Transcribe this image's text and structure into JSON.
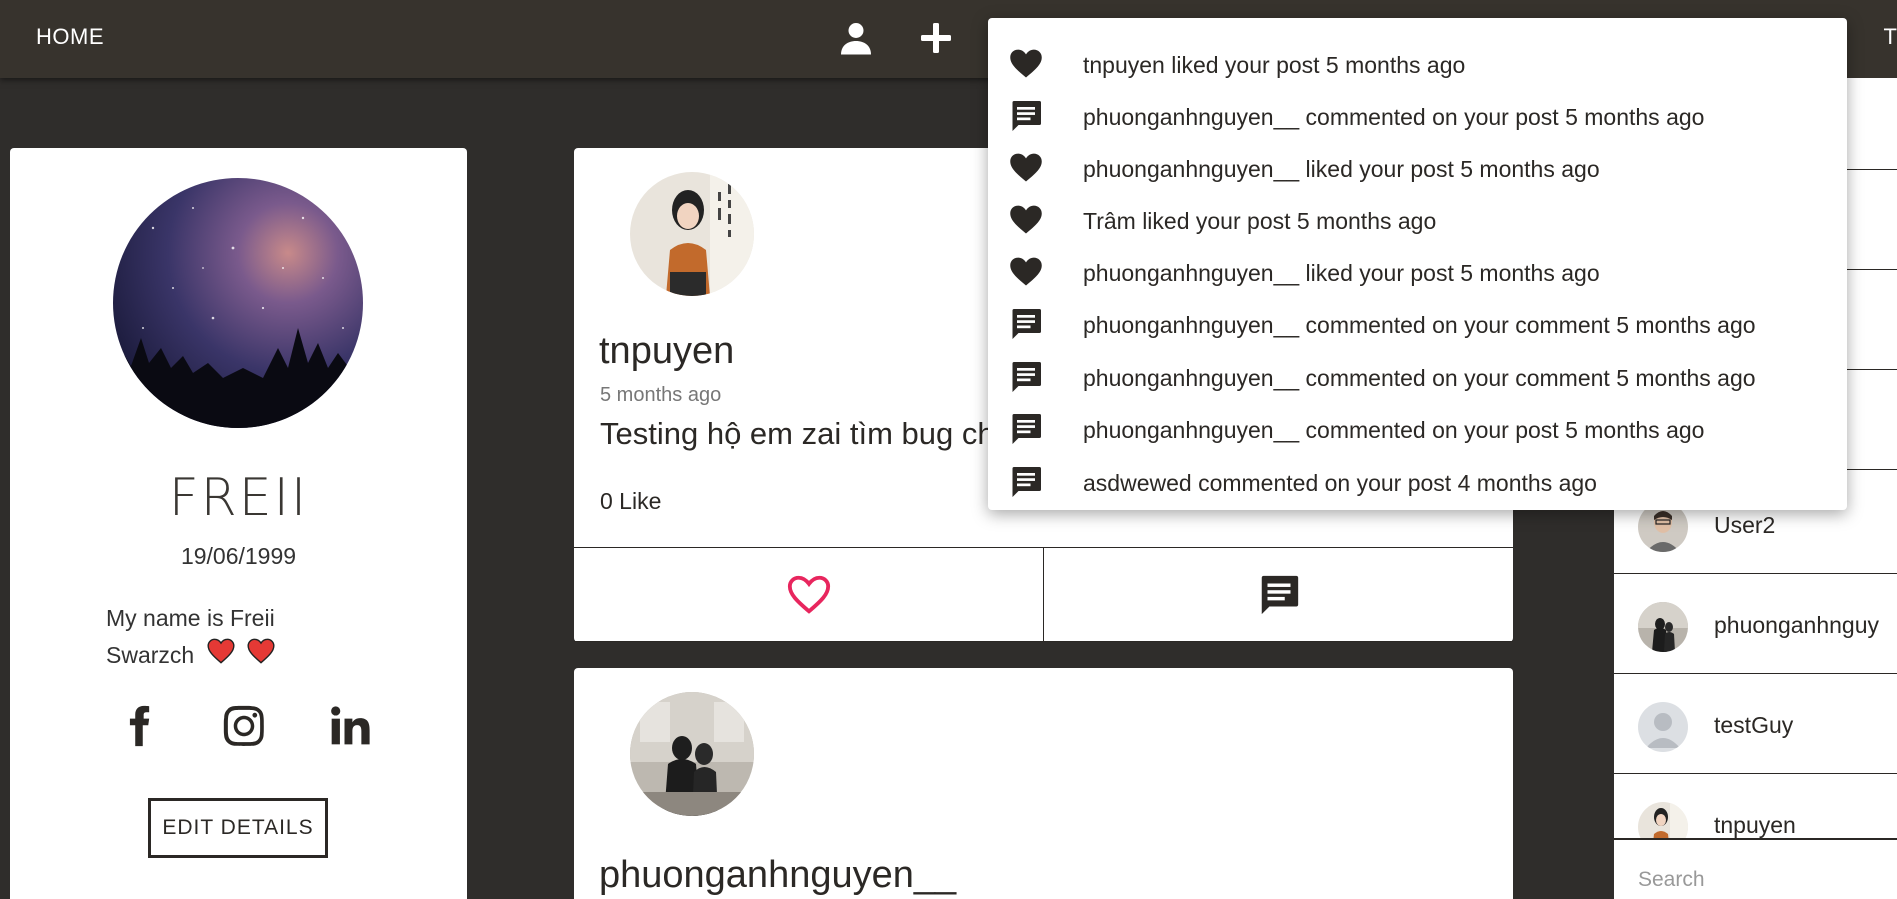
{
  "nav": {
    "home_label": "HOME",
    "right_label": "T",
    "profile_icon": "user-icon",
    "add_icon": "plus-icon"
  },
  "profile": {
    "name": "FREII",
    "dob": "19/06/1999",
    "bio": "My name is Freii Swarzch",
    "edit_label": "EDIT DETAILS",
    "socials": [
      "facebook-icon",
      "instagram-icon",
      "linkedin-icon"
    ]
  },
  "posts": [
    {
      "author": "tnpuyen",
      "time": "5 months ago",
      "text": "Testing hộ em zai tìm bug ch",
      "likes": "0 Like"
    },
    {
      "author": "phuonganhnguyen__"
    }
  ],
  "users": [
    {
      "name": "User2"
    },
    {
      "name": "phuonganhnguy"
    },
    {
      "name": "testGuy"
    },
    {
      "name": "tnpuyen"
    }
  ],
  "search": {
    "placeholder": "Search"
  },
  "notifications": [
    {
      "type": "like",
      "icon": "heart-icon",
      "text": "tnpuyen liked your post 5 months ago"
    },
    {
      "type": "comment",
      "icon": "comment-icon",
      "text": "phuonganhnguyen__ commented on your post 5 months ago"
    },
    {
      "type": "like",
      "icon": "heart-icon",
      "text": "phuonganhnguyen__ liked your post 5 months ago"
    },
    {
      "type": "like",
      "icon": "heart-icon",
      "text": "Trâm liked your post 5 months ago"
    },
    {
      "type": "like",
      "icon": "heart-icon",
      "text": "phuonganhnguyen__ liked your post 5 months ago"
    },
    {
      "type": "comment",
      "icon": "comment-icon",
      "text": "phuonganhnguyen__ commented on your comment 5 months ago"
    },
    {
      "type": "comment",
      "icon": "comment-icon",
      "text": "phuonganhnguyen__ commented on your comment 5 months ago"
    },
    {
      "type": "comment",
      "icon": "comment-icon",
      "text": "phuonganhnguyen__ commented on your post 5 months ago"
    },
    {
      "type": "comment",
      "icon": "comment-icon",
      "text": "asdwewed commented on your post 4 months ago"
    }
  ],
  "colors": {
    "topbar": "#37332d",
    "background": "#2f2d2b",
    "like_accent": "#e8265e"
  }
}
